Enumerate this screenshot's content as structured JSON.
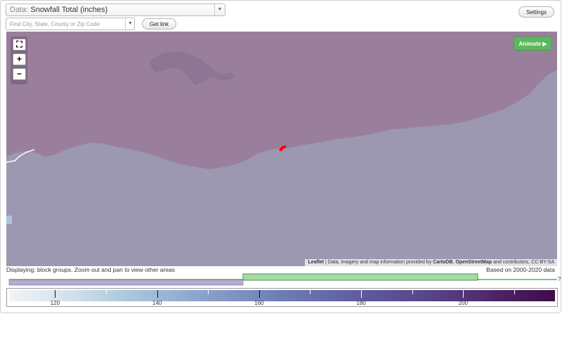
{
  "controls": {
    "data_label": "Data:",
    "data_value": "Snowfall Total (inches)",
    "search_placeholder": "Find City, State, County or Zip Code",
    "get_link_label": "Get link",
    "settings_label": "Settings"
  },
  "map": {
    "animate_label": "Animate ▶",
    "zoom_in": "+",
    "zoom_out": "−",
    "fullscreen_icon": "fullscreen-icon",
    "attribution": {
      "leaflet": "Leaflet",
      "text1": " | Data, imagery and map information provided by ",
      "carto": "CartoDB",
      "sep": ", ",
      "osm": "OpenStreetMap",
      "text2": " and contributors, CC-BY-SA"
    },
    "colors": {
      "land_upper": "#9a7f9d",
      "land_lower": "#9d98b1",
      "water": "#7b6b86",
      "marker": "#ff0000"
    }
  },
  "status": {
    "displaying": "Displaying: block groups. Zoom out and pan to view other areas",
    "based_on": "Based on 2000-2020 data"
  },
  "timeline": {
    "end_marker": "?"
  },
  "legend": {
    "range": [
      111,
      218
    ],
    "ticks": [
      {
        "value": 120,
        "label": "120"
      },
      {
        "value": 130,
        "label": ""
      },
      {
        "value": 140,
        "label": "140"
      },
      {
        "value": 150,
        "label": ""
      },
      {
        "value": 160,
        "label": "160"
      },
      {
        "value": 170,
        "label": ""
      },
      {
        "value": 180,
        "label": "180"
      },
      {
        "value": 190,
        "label": ""
      },
      {
        "value": 200,
        "label": "200"
      },
      {
        "value": 210,
        "label": ""
      }
    ]
  }
}
